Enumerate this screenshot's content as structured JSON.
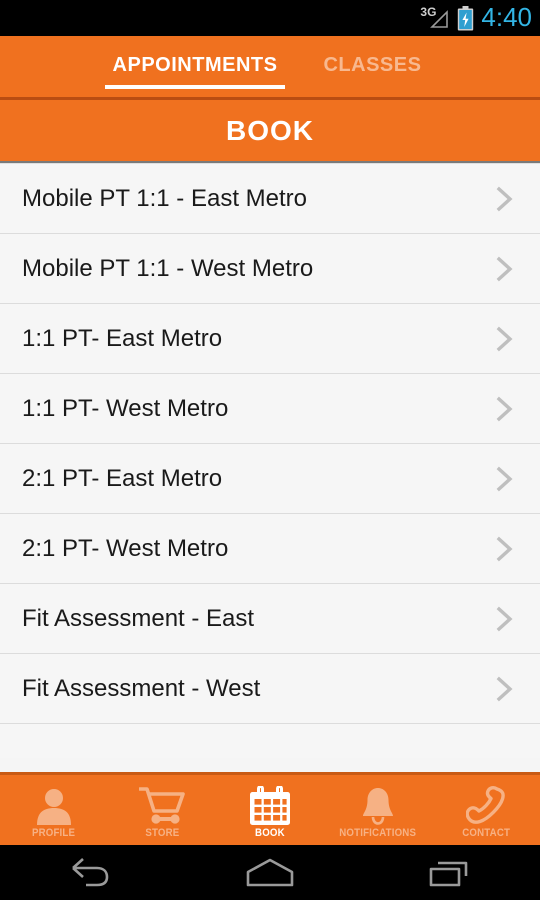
{
  "statusbar": {
    "network_label": "3G",
    "time": "4:40",
    "time_color": "#33b5e5",
    "battery_state": "charging"
  },
  "theme": {
    "accent_orange": "#f0711f",
    "header_border": "#b94d12",
    "list_bg": "#f6f6f6",
    "row_divider": "#dcdcdc",
    "chevron_gray": "#bfbfbf",
    "text_primary": "#1a1a1a"
  },
  "tabs": {
    "items": [
      {
        "label": "APPOINTMENTS",
        "active": true
      },
      {
        "label": "CLASSES",
        "active": false
      }
    ]
  },
  "section_header": {
    "title": "BOOK"
  },
  "list": {
    "rows": [
      {
        "label": "Mobile PT 1:1 - East Metro"
      },
      {
        "label": "Mobile PT 1:1 - West Metro"
      },
      {
        "label": "1:1 PT- East Metro"
      },
      {
        "label": "1:1 PT- West Metro"
      },
      {
        "label": "2:1 PT- East Metro"
      },
      {
        "label": "2:1 PT- West Metro"
      },
      {
        "label": "Fit Assessment - East"
      },
      {
        "label": "Fit Assessment - West"
      }
    ]
  },
  "bottom_nav": {
    "items": [
      {
        "label": "PROFILE",
        "icon": "person-icon",
        "active": false
      },
      {
        "label": "STORE",
        "icon": "cart-icon",
        "active": false
      },
      {
        "label": "BOOK",
        "icon": "calendar-icon",
        "active": true
      },
      {
        "label": "NOTIFICATIONS",
        "icon": "bell-icon",
        "active": false
      },
      {
        "label": "CONTACT",
        "icon": "phone-icon",
        "active": false
      }
    ]
  },
  "android_nav": {
    "items": [
      {
        "name": "back-icon"
      },
      {
        "name": "home-icon"
      },
      {
        "name": "recents-icon"
      }
    ]
  }
}
